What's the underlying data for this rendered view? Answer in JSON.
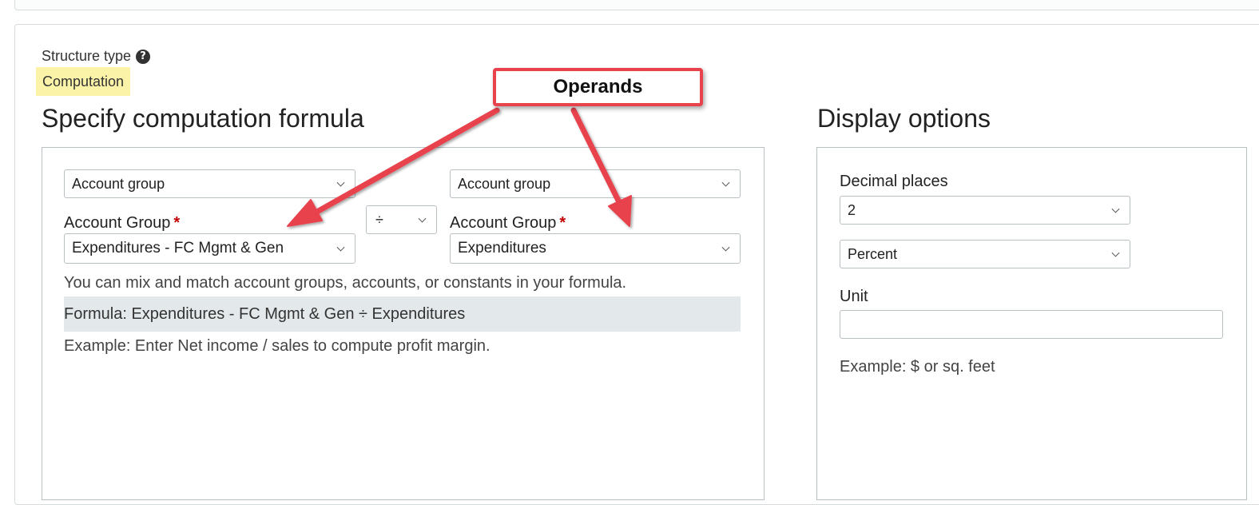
{
  "structure": {
    "label": "Structure type",
    "value": "Computation"
  },
  "formula_section": {
    "heading": "Specify computation formula",
    "left_operand": {
      "type_select": "Account group",
      "label": "Account Group",
      "required_mark": "*",
      "value": "Expenditures - FC Mgmt & Gen"
    },
    "operator": "÷",
    "right_operand": {
      "type_select": "Account group",
      "label": "Account Group",
      "required_mark": "*",
      "value": "Expenditures"
    },
    "help_text": "You can mix and match account groups, accounts, or constants in your formula.",
    "formula": "Formula: Expenditures - FC Mgmt & Gen ÷ Expenditures",
    "example": "Example: Enter Net income / sales to compute profit margin."
  },
  "display_section": {
    "heading": "Display options",
    "decimal_label": "Decimal places",
    "decimal_value": "2",
    "format_value": "Percent",
    "unit_label": "Unit",
    "unit_value": "",
    "example": "Example: $ or sq. feet"
  },
  "annotation": {
    "callout": "Operands",
    "color": "#e8424d"
  },
  "icons": {
    "help": "question-circle-icon",
    "dropdown": "chevron-down-icon"
  }
}
